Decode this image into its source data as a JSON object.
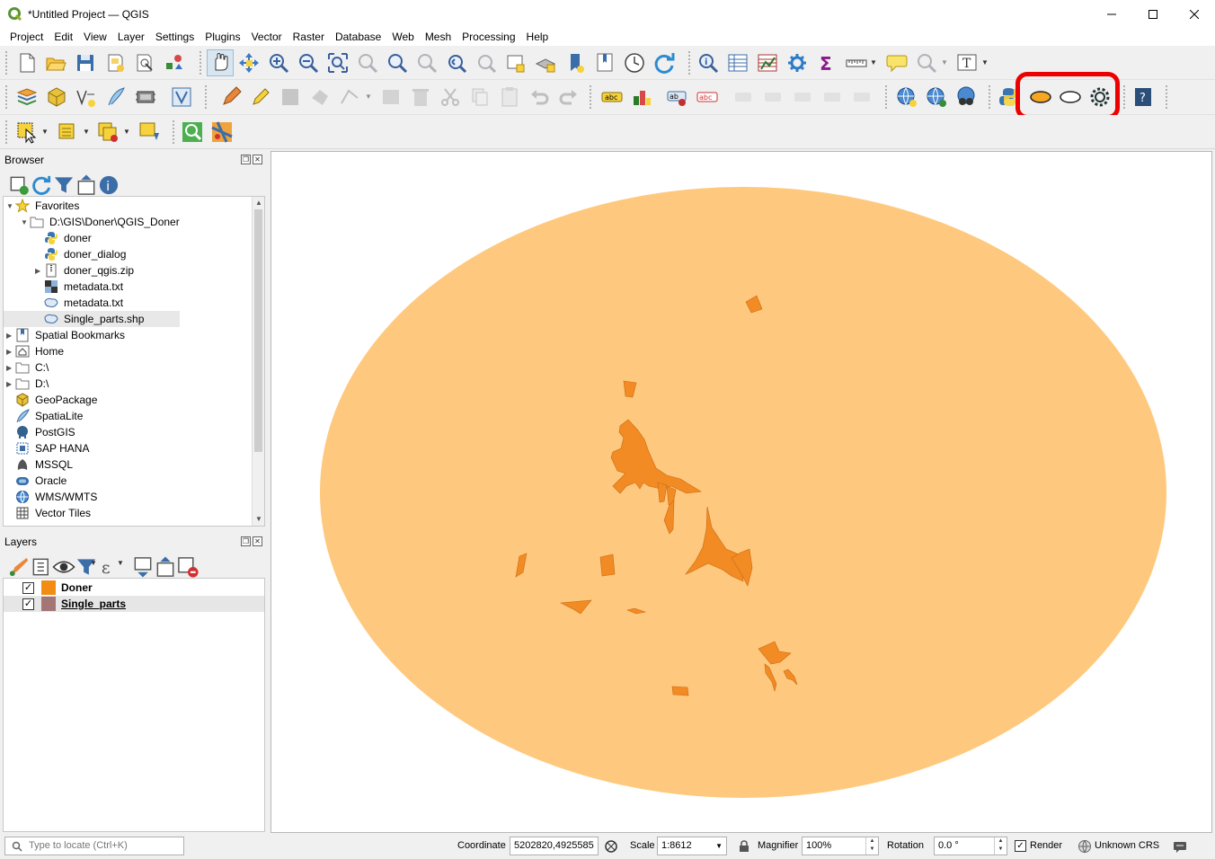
{
  "window": {
    "title": "*Untitled Project — QGIS"
  },
  "menu": [
    "Project",
    "Edit",
    "View",
    "Layer",
    "Settings",
    "Plugins",
    "Vector",
    "Raster",
    "Database",
    "Web",
    "Mesh",
    "Processing",
    "Help"
  ],
  "browser": {
    "title": "Browser",
    "items": [
      {
        "label": "Favorites",
        "icon": "star-icon"
      },
      {
        "label": "D:\\GIS\\Doner\\QGIS_Doner",
        "icon": "folder-icon"
      },
      {
        "label": "doner",
        "icon": "python-icon"
      },
      {
        "label": "doner_dialog",
        "icon": "python-icon"
      },
      {
        "label": "doner_qgis.zip",
        "icon": "zip-icon"
      },
      {
        "label": "metadata.txt",
        "icon": "raster-icon"
      },
      {
        "label": "metadata.txt",
        "icon": "vector-polygon-icon"
      },
      {
        "label": "Single_parts.shp",
        "icon": "vector-polygon-icon"
      },
      {
        "label": "Spatial Bookmarks",
        "icon": "bookmark-icon"
      },
      {
        "label": "Home",
        "icon": "home-icon"
      },
      {
        "label": "C:\\",
        "icon": "drive-icon"
      },
      {
        "label": "D:\\",
        "icon": "drive-icon"
      },
      {
        "label": "GeoPackage",
        "icon": "geopackage-icon"
      },
      {
        "label": "SpatiaLite",
        "icon": "spatialite-icon"
      },
      {
        "label": "PostGIS",
        "icon": "postgis-icon"
      },
      {
        "label": "SAP HANA",
        "icon": "hana-icon"
      },
      {
        "label": "MSSQL",
        "icon": "mssql-icon"
      },
      {
        "label": "Oracle",
        "icon": "oracle-icon"
      },
      {
        "label": "WMS/WMTS",
        "icon": "wms-icon"
      },
      {
        "label": "Vector Tiles",
        "icon": "vector-tiles-icon"
      }
    ]
  },
  "layers": {
    "title": "Layers",
    "items": [
      {
        "label": "Doner",
        "checked": true,
        "color": "#f28c13"
      },
      {
        "label": "Single_parts",
        "checked": true,
        "color": "#a37575"
      }
    ]
  },
  "statusbar": {
    "locator_placeholder": "Type to locate (Ctrl+K)",
    "coordinate_label": "Coordinate",
    "coordinate_value": "5202820,4925585",
    "scale_label": "Scale",
    "scale_value": "1:8612",
    "magnifier_label": "Magnifier",
    "magnifier_value": "100%",
    "rotation_label": "Rotation",
    "rotation_value": "0.0 °",
    "render_label": "Render",
    "crs_label": "Unknown CRS"
  },
  "colors": {
    "ellipse_fill": "#fec97e",
    "parts_fill": "#f28b24",
    "highlight": "#ec0000"
  }
}
